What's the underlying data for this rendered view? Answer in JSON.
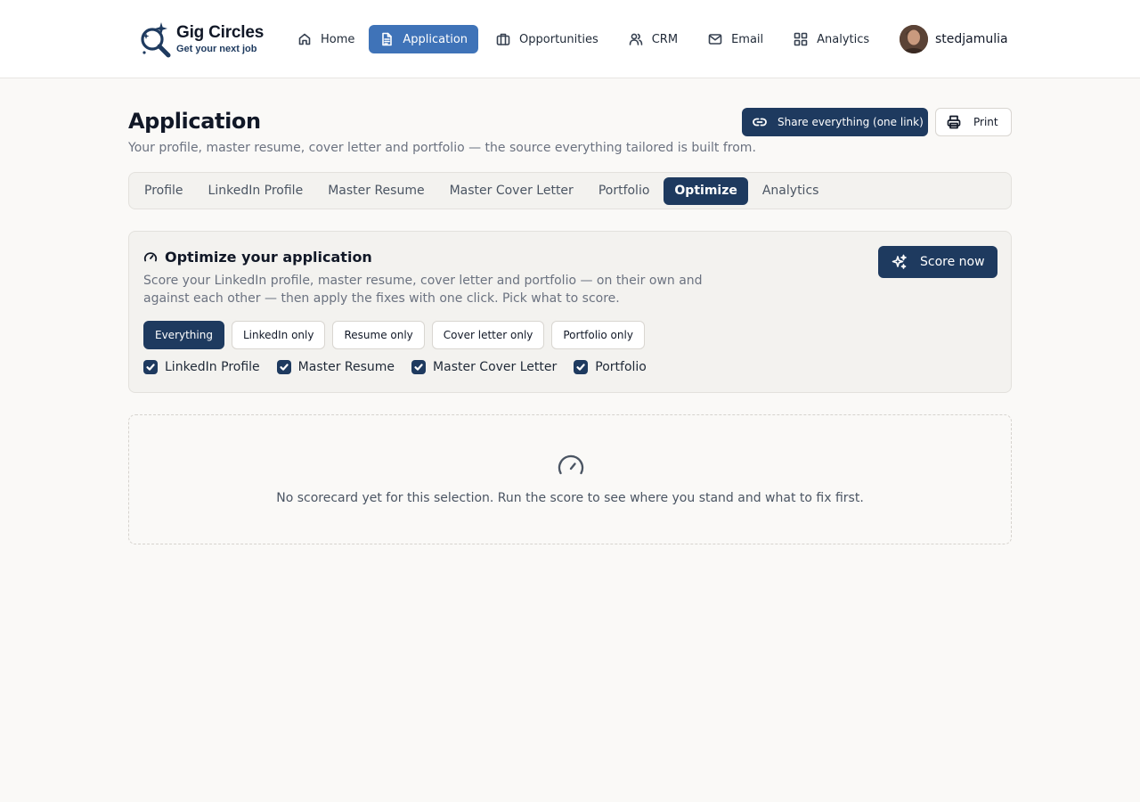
{
  "app": {
    "name": "Gig Circles",
    "tagline": "Get your next job"
  },
  "nav": {
    "items": [
      {
        "label": "Home",
        "icon": "home-icon"
      },
      {
        "label": "Application",
        "icon": "document-icon",
        "active": true
      },
      {
        "label": "Opportunities",
        "icon": "briefcase-icon"
      },
      {
        "label": "CRM",
        "icon": "users-icon"
      },
      {
        "label": "Email",
        "icon": "mail-icon"
      },
      {
        "label": "Analytics",
        "icon": "grid-icon"
      }
    ]
  },
  "user": {
    "name": "stedjamulia"
  },
  "header": {
    "title": "Application",
    "subtitle": "Your profile, master resume, cover letter and portfolio — the source everything tailored is built from.",
    "share_label": "Share everything (one link)",
    "print_label": "Print"
  },
  "tabs": [
    {
      "label": "Profile"
    },
    {
      "label": "LinkedIn Profile"
    },
    {
      "label": "Master Resume"
    },
    {
      "label": "Master Cover Letter"
    },
    {
      "label": "Portfolio"
    },
    {
      "label": "Optimize",
      "active": true
    },
    {
      "label": "Analytics"
    }
  ],
  "optimize": {
    "title": "Optimize your application",
    "description": "Score your LinkedIn profile, master resume, cover letter and portfolio — on their own and against each other — then apply the fixes with one click. Pick what to score.",
    "score_button": "Score now",
    "scopes": [
      {
        "label": "Everything",
        "active": true
      },
      {
        "label": "LinkedIn only"
      },
      {
        "label": "Resume only"
      },
      {
        "label": "Cover letter only"
      },
      {
        "label": "Portfolio only"
      }
    ],
    "checkboxes": [
      {
        "label": "LinkedIn Profile",
        "checked": true
      },
      {
        "label": "Master Resume",
        "checked": true
      },
      {
        "label": "Master Cover Letter",
        "checked": true
      },
      {
        "label": "Portfolio",
        "checked": true
      }
    ]
  },
  "empty_state": {
    "message": "No scorecard yet for this selection. Run the score to see where you stand and what to fix first."
  },
  "colors": {
    "primary": "#1e3a5f",
    "nav_active": "#3f73b8",
    "background": "#faf9f7"
  }
}
